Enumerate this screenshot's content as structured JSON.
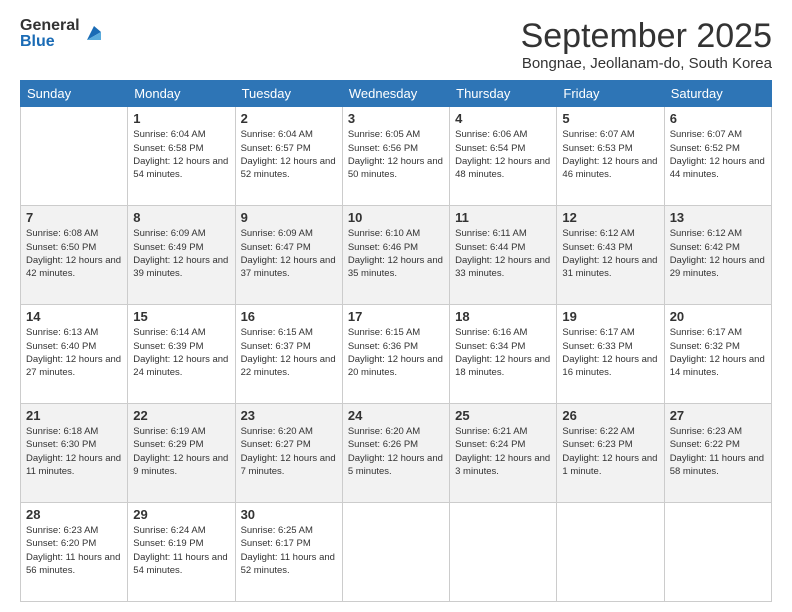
{
  "logo": {
    "general": "General",
    "blue": "Blue"
  },
  "title": "September 2025",
  "location": "Bongnae, Jeollanam-do, South Korea",
  "days_of_week": [
    "Sunday",
    "Monday",
    "Tuesday",
    "Wednesday",
    "Thursday",
    "Friday",
    "Saturday"
  ],
  "weeks": [
    [
      {
        "day": "",
        "sunrise": "",
        "sunset": "",
        "daylight": ""
      },
      {
        "day": "1",
        "sunrise": "Sunrise: 6:04 AM",
        "sunset": "Sunset: 6:58 PM",
        "daylight": "Daylight: 12 hours and 54 minutes."
      },
      {
        "day": "2",
        "sunrise": "Sunrise: 6:04 AM",
        "sunset": "Sunset: 6:57 PM",
        "daylight": "Daylight: 12 hours and 52 minutes."
      },
      {
        "day": "3",
        "sunrise": "Sunrise: 6:05 AM",
        "sunset": "Sunset: 6:56 PM",
        "daylight": "Daylight: 12 hours and 50 minutes."
      },
      {
        "day": "4",
        "sunrise": "Sunrise: 6:06 AM",
        "sunset": "Sunset: 6:54 PM",
        "daylight": "Daylight: 12 hours and 48 minutes."
      },
      {
        "day": "5",
        "sunrise": "Sunrise: 6:07 AM",
        "sunset": "Sunset: 6:53 PM",
        "daylight": "Daylight: 12 hours and 46 minutes."
      },
      {
        "day": "6",
        "sunrise": "Sunrise: 6:07 AM",
        "sunset": "Sunset: 6:52 PM",
        "daylight": "Daylight: 12 hours and 44 minutes."
      }
    ],
    [
      {
        "day": "7",
        "sunrise": "Sunrise: 6:08 AM",
        "sunset": "Sunset: 6:50 PM",
        "daylight": "Daylight: 12 hours and 42 minutes."
      },
      {
        "day": "8",
        "sunrise": "Sunrise: 6:09 AM",
        "sunset": "Sunset: 6:49 PM",
        "daylight": "Daylight: 12 hours and 39 minutes."
      },
      {
        "day": "9",
        "sunrise": "Sunrise: 6:09 AM",
        "sunset": "Sunset: 6:47 PM",
        "daylight": "Daylight: 12 hours and 37 minutes."
      },
      {
        "day": "10",
        "sunrise": "Sunrise: 6:10 AM",
        "sunset": "Sunset: 6:46 PM",
        "daylight": "Daylight: 12 hours and 35 minutes."
      },
      {
        "day": "11",
        "sunrise": "Sunrise: 6:11 AM",
        "sunset": "Sunset: 6:44 PM",
        "daylight": "Daylight: 12 hours and 33 minutes."
      },
      {
        "day": "12",
        "sunrise": "Sunrise: 6:12 AM",
        "sunset": "Sunset: 6:43 PM",
        "daylight": "Daylight: 12 hours and 31 minutes."
      },
      {
        "day": "13",
        "sunrise": "Sunrise: 6:12 AM",
        "sunset": "Sunset: 6:42 PM",
        "daylight": "Daylight: 12 hours and 29 minutes."
      }
    ],
    [
      {
        "day": "14",
        "sunrise": "Sunrise: 6:13 AM",
        "sunset": "Sunset: 6:40 PM",
        "daylight": "Daylight: 12 hours and 27 minutes."
      },
      {
        "day": "15",
        "sunrise": "Sunrise: 6:14 AM",
        "sunset": "Sunset: 6:39 PM",
        "daylight": "Daylight: 12 hours and 24 minutes."
      },
      {
        "day": "16",
        "sunrise": "Sunrise: 6:15 AM",
        "sunset": "Sunset: 6:37 PM",
        "daylight": "Daylight: 12 hours and 22 minutes."
      },
      {
        "day": "17",
        "sunrise": "Sunrise: 6:15 AM",
        "sunset": "Sunset: 6:36 PM",
        "daylight": "Daylight: 12 hours and 20 minutes."
      },
      {
        "day": "18",
        "sunrise": "Sunrise: 6:16 AM",
        "sunset": "Sunset: 6:34 PM",
        "daylight": "Daylight: 12 hours and 18 minutes."
      },
      {
        "day": "19",
        "sunrise": "Sunrise: 6:17 AM",
        "sunset": "Sunset: 6:33 PM",
        "daylight": "Daylight: 12 hours and 16 minutes."
      },
      {
        "day": "20",
        "sunrise": "Sunrise: 6:17 AM",
        "sunset": "Sunset: 6:32 PM",
        "daylight": "Daylight: 12 hours and 14 minutes."
      }
    ],
    [
      {
        "day": "21",
        "sunrise": "Sunrise: 6:18 AM",
        "sunset": "Sunset: 6:30 PM",
        "daylight": "Daylight: 12 hours and 11 minutes."
      },
      {
        "day": "22",
        "sunrise": "Sunrise: 6:19 AM",
        "sunset": "Sunset: 6:29 PM",
        "daylight": "Daylight: 12 hours and 9 minutes."
      },
      {
        "day": "23",
        "sunrise": "Sunrise: 6:20 AM",
        "sunset": "Sunset: 6:27 PM",
        "daylight": "Daylight: 12 hours and 7 minutes."
      },
      {
        "day": "24",
        "sunrise": "Sunrise: 6:20 AM",
        "sunset": "Sunset: 6:26 PM",
        "daylight": "Daylight: 12 hours and 5 minutes."
      },
      {
        "day": "25",
        "sunrise": "Sunrise: 6:21 AM",
        "sunset": "Sunset: 6:24 PM",
        "daylight": "Daylight: 12 hours and 3 minutes."
      },
      {
        "day": "26",
        "sunrise": "Sunrise: 6:22 AM",
        "sunset": "Sunset: 6:23 PM",
        "daylight": "Daylight: 12 hours and 1 minute."
      },
      {
        "day": "27",
        "sunrise": "Sunrise: 6:23 AM",
        "sunset": "Sunset: 6:22 PM",
        "daylight": "Daylight: 11 hours and 58 minutes."
      }
    ],
    [
      {
        "day": "28",
        "sunrise": "Sunrise: 6:23 AM",
        "sunset": "Sunset: 6:20 PM",
        "daylight": "Daylight: 11 hours and 56 minutes."
      },
      {
        "day": "29",
        "sunrise": "Sunrise: 6:24 AM",
        "sunset": "Sunset: 6:19 PM",
        "daylight": "Daylight: 11 hours and 54 minutes."
      },
      {
        "day": "30",
        "sunrise": "Sunrise: 6:25 AM",
        "sunset": "Sunset: 6:17 PM",
        "daylight": "Daylight: 11 hours and 52 minutes."
      },
      {
        "day": "",
        "sunrise": "",
        "sunset": "",
        "daylight": ""
      },
      {
        "day": "",
        "sunrise": "",
        "sunset": "",
        "daylight": ""
      },
      {
        "day": "",
        "sunrise": "",
        "sunset": "",
        "daylight": ""
      },
      {
        "day": "",
        "sunrise": "",
        "sunset": "",
        "daylight": ""
      }
    ]
  ]
}
